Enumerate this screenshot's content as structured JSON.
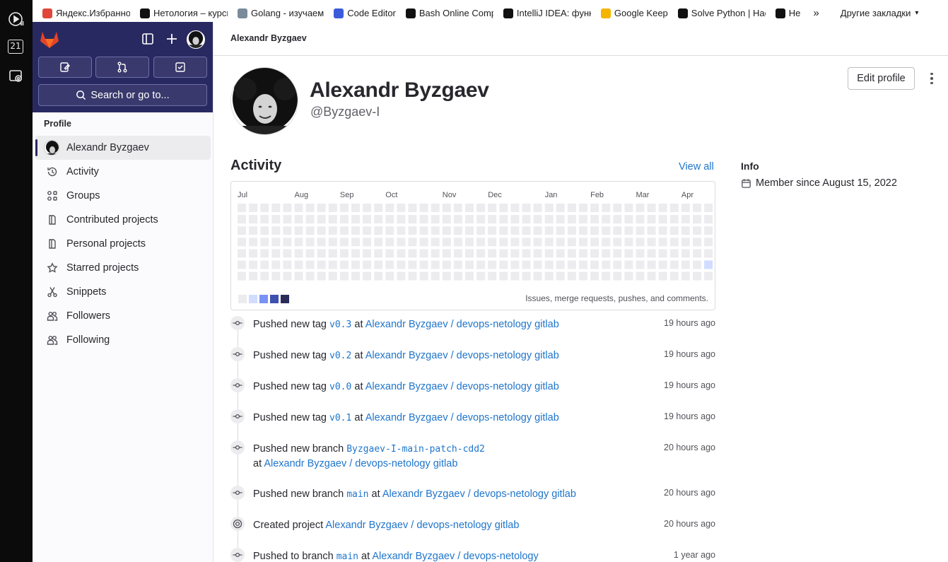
{
  "bookmarks": [
    {
      "label": "Яндекс.Избранное",
      "color": "#e0463a"
    },
    {
      "label": "Нетология – курсы",
      "color": "#111111"
    },
    {
      "label": "Golang - изучаем",
      "color": "#7a8b99"
    },
    {
      "label": "Code Editor",
      "color": "#3b5bdb"
    },
    {
      "label": "Bash Online Compiler",
      "color": "#111111"
    },
    {
      "label": "IntelliJ IDEA: функции",
      "color": "#111111"
    },
    {
      "label": "Google Keep",
      "color": "#f4b400"
    },
    {
      "label": "Solve Python | HackerRank",
      "color": "#111111"
    },
    {
      "label": "He",
      "color": "#111111"
    }
  ],
  "bookmarks_more": "»",
  "bookmarks_other": "Другие закладки",
  "appbar": {
    "badge": "21"
  },
  "sidebar": {
    "search_label": "Search or go to...",
    "section": "Profile",
    "user_item": "Alexandr Byzgaev",
    "items": [
      {
        "label": "Activity",
        "icon": "history-icon"
      },
      {
        "label": "Groups",
        "icon": "groups-icon"
      },
      {
        "label": "Contributed projects",
        "icon": "project-icon"
      },
      {
        "label": "Personal projects",
        "icon": "project-icon"
      },
      {
        "label": "Starred projects",
        "icon": "star-icon"
      },
      {
        "label": "Snippets",
        "icon": "snippet-icon"
      },
      {
        "label": "Followers",
        "icon": "users-icon"
      },
      {
        "label": "Following",
        "icon": "users-icon"
      }
    ]
  },
  "breadcrumb": "Alexandr Byzgaev",
  "profile": {
    "name": "Alexandr Byzgaev",
    "handle": "@Byzgaev-I",
    "edit_label": "Edit profile"
  },
  "activity": {
    "title": "Activity",
    "view_all": "View all",
    "months": [
      "Jul",
      "Aug",
      "Sep",
      "Oct",
      "Nov",
      "Dec",
      "Jan",
      "Feb",
      "Mar",
      "Apr"
    ],
    "legend_note": "Issues, merge requests, pushes, and comments.",
    "legend_colors": [
      "#ececef",
      "#d2dcff",
      "#7992f5",
      "#3f51ae",
      "#2a2b59"
    ],
    "active_cells": [
      {
        "week": 41,
        "day": 5,
        "level": 1
      }
    ]
  },
  "info": {
    "title": "Info",
    "member_since": "Member since August 15, 2022"
  },
  "events": [
    {
      "action": "Pushed new tag",
      "ref": "v0.3",
      "at": "at",
      "project": "Alexandr Byzgaev / devops-netology gitlab",
      "time": "19 hours ago"
    },
    {
      "action": "Pushed new tag",
      "ref": "v0.2",
      "at": "at",
      "project": "Alexandr Byzgaev / devops-netology gitlab",
      "time": "19 hours ago"
    },
    {
      "action": "Pushed new tag",
      "ref": "v0.0",
      "at": "at",
      "project": "Alexandr Byzgaev / devops-netology gitlab",
      "time": "19 hours ago"
    },
    {
      "action": "Pushed new tag",
      "ref": "v0.1",
      "at": "at",
      "project": "Alexandr Byzgaev / devops-netology gitlab",
      "time": "19 hours ago"
    },
    {
      "action": "Pushed new branch",
      "ref": "Byzgaev-I-main-patch-cdd2",
      "at": "at",
      "project": "Alexandr Byzgaev / devops-netology gitlab",
      "time": "20 hours ago"
    },
    {
      "action": "Pushed new branch",
      "ref": "main",
      "at": "at",
      "project": "Alexandr Byzgaev / devops-netology gitlab",
      "time": "20 hours ago"
    },
    {
      "action": "Created project",
      "ref": "",
      "at": "",
      "project": "Alexandr Byzgaev / devops-netology gitlab",
      "time": "20 hours ago"
    },
    {
      "action": "Pushed to branch",
      "ref": "main",
      "at": "at",
      "project": "Alexandr Byzgaev / devops-netology",
      "time": "1 year ago"
    }
  ]
}
